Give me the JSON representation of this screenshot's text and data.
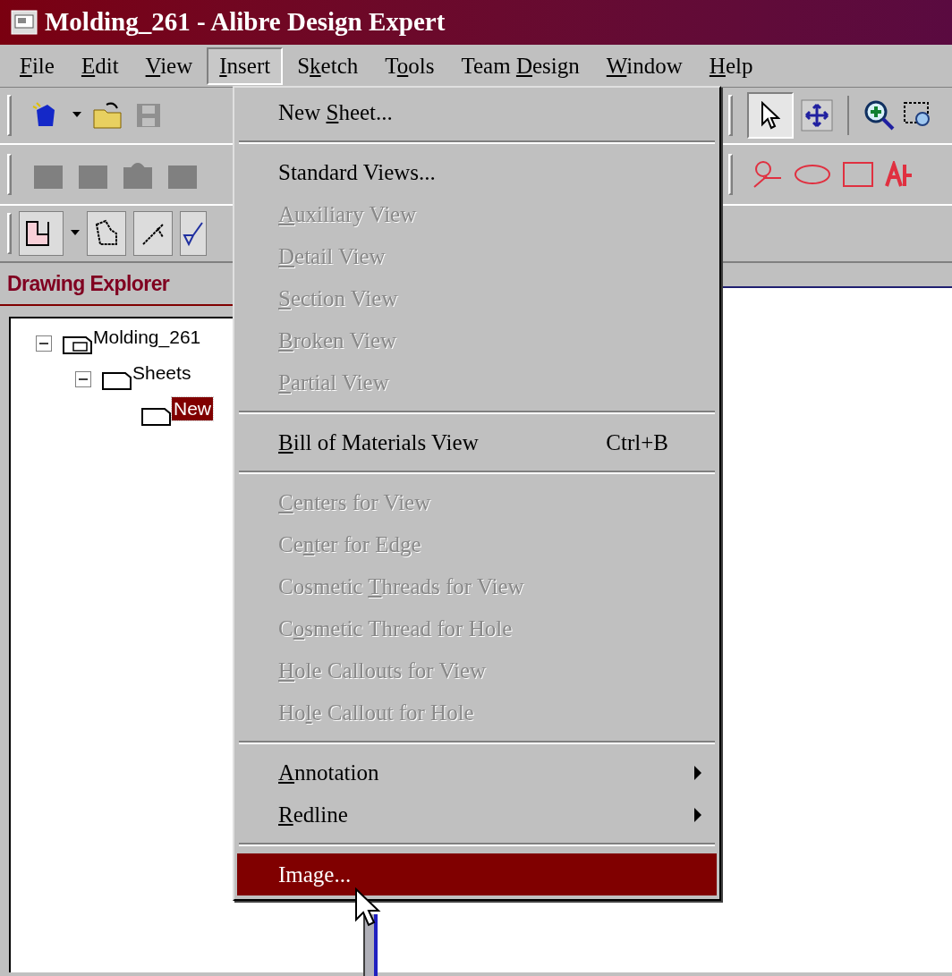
{
  "window": {
    "title": "Molding_261 - Alibre Design Expert"
  },
  "menu_bar": [
    {
      "key": "F",
      "post": "ile",
      "selected": false
    },
    {
      "key": "E",
      "post": "dit",
      "selected": false
    },
    {
      "key": "V",
      "post": "iew",
      "selected": false
    },
    {
      "key": "I",
      "post": "nsert",
      "selected": true
    },
    {
      "pre": "S",
      "key": "k",
      "post": "etch",
      "selected": false
    },
    {
      "pre": "T",
      "key": "o",
      "post": "ols",
      "selected": false
    },
    {
      "pre": "Team ",
      "key": "D",
      "post": "esign",
      "selected": false
    },
    {
      "key": "W",
      "post": "indow",
      "selected": false
    },
    {
      "key": "H",
      "post": "elp",
      "selected": false
    }
  ],
  "panel": {
    "title": "Drawing Explorer",
    "tree": [
      {
        "label": "Molding_261",
        "expanded": true,
        "selected": false,
        "children": [
          {
            "label": "Sheets",
            "expanded": true,
            "selected": false,
            "children": [
              {
                "label": "New",
                "selected": true
              }
            ]
          }
        ]
      }
    ]
  },
  "insert_menu": [
    {
      "kind": "item",
      "pre": "New ",
      "key": "S",
      "post": "heet...",
      "disabled": false,
      "selected": false
    },
    {
      "kind": "separator"
    },
    {
      "kind": "item",
      "pre": "Standard Views...",
      "disabled": false,
      "selected": false
    },
    {
      "kind": "item",
      "key": "A",
      "post": "uxiliary View",
      "disabled": true,
      "selected": false
    },
    {
      "kind": "item",
      "key": "D",
      "post": "etail View",
      "disabled": true,
      "selected": false
    },
    {
      "kind": "item",
      "key": "S",
      "post": "ection View",
      "disabled": true,
      "selected": false
    },
    {
      "kind": "item",
      "key": "B",
      "post": "roken View",
      "disabled": true,
      "selected": false
    },
    {
      "kind": "item",
      "key": "P",
      "post": "artial View",
      "disabled": true,
      "selected": false
    },
    {
      "kind": "separator"
    },
    {
      "kind": "item",
      "key": "B",
      "post": "ill of Materials View",
      "shortcut": "Ctrl+B",
      "disabled": false,
      "selected": false
    },
    {
      "kind": "separator"
    },
    {
      "kind": "item",
      "key": "C",
      "post": "enters for View",
      "disabled": true,
      "selected": false
    },
    {
      "kind": "item",
      "pre": "Ce",
      "key": "n",
      "post": "ter for Edge",
      "disabled": true,
      "selected": false
    },
    {
      "kind": "item",
      "pre": "Cosmetic ",
      "key": "T",
      "post": "hreads for View",
      "disabled": true,
      "selected": false
    },
    {
      "kind": "item",
      "pre": "C",
      "key": "o",
      "post": "smetic Thread for Hole",
      "disabled": true,
      "selected": false
    },
    {
      "kind": "item",
      "key": "H",
      "post": "ole Callouts for View",
      "disabled": true,
      "selected": false
    },
    {
      "kind": "item",
      "pre": "Ho",
      "key": "l",
      "post": "e Callout for Hole",
      "disabled": true,
      "selected": false
    },
    {
      "kind": "separator"
    },
    {
      "kind": "item",
      "key": "A",
      "post": "nnotation",
      "submenu": true,
      "disabled": false,
      "selected": false
    },
    {
      "kind": "item",
      "key": "R",
      "post": "edline",
      "submenu": true,
      "disabled": false,
      "selected": false
    },
    {
      "kind": "separator"
    },
    {
      "kind": "item",
      "pre": "Image...",
      "disabled": false,
      "selected": true
    }
  ]
}
